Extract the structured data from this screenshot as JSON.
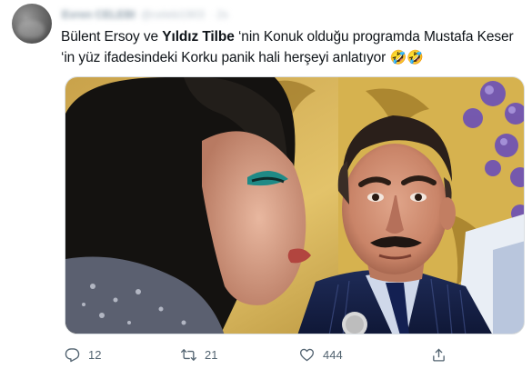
{
  "tweet": {
    "author_name": "Evren CELEBI",
    "author_handle": "@celebi1903",
    "time": "· 2s",
    "text_part1": "Bülent Ersoy ve ",
    "mention": "Yıldız Tilbe",
    "text_part2": " ‘nin Konuk olduğu programda Mustafa Keser ‘in yüz ifadesindeki Korku panik hali herşeyi anlatıyor ",
    "emoji": "🤣🤣"
  },
  "actions": {
    "reply_count": "12",
    "retweet_count": "21",
    "like_count": "444"
  },
  "icons": {
    "reply": "reply-icon",
    "retweet": "retweet-icon",
    "like": "heart-icon",
    "share": "share-icon"
  },
  "colors": {
    "text": "#0f1419",
    "secondary": "#536471",
    "background": "#ffffff"
  }
}
